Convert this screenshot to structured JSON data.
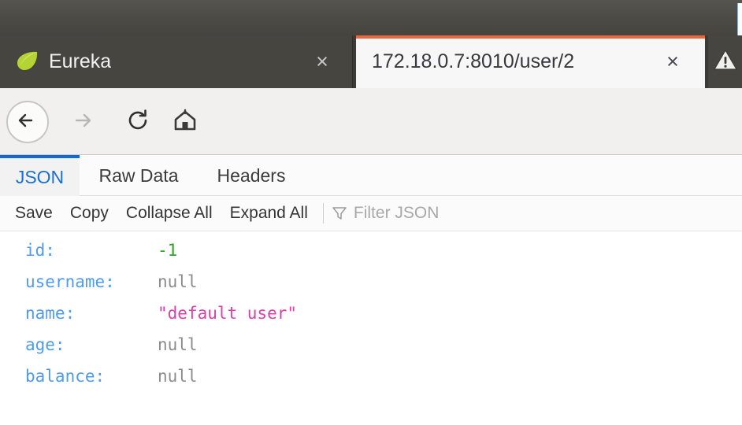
{
  "window": {
    "titlebar_color": "#4b4a45"
  },
  "tabs": {
    "accent_color": "#e8673d",
    "items": [
      {
        "title": "Eureka",
        "icon": "leaf-icon",
        "close_label": "×",
        "active": false
      },
      {
        "title": "172.18.0.7:8010/user/2",
        "icon": "none",
        "close_label": "×",
        "active": true
      },
      {
        "title": "",
        "icon": "warning-triangle-icon",
        "close_label": "",
        "active": false
      }
    ]
  },
  "navbar": {
    "back_label": "←",
    "forward_label": "→",
    "reload_label": "↻",
    "home_label": "⌂",
    "security_icon": "broken-lock-icon",
    "url_host": "172.18.0.7",
    "url_rest": ":8010/user/2",
    "url_full": "172.18.0.7:8010/user/2"
  },
  "viewer": {
    "tabs": [
      {
        "label": "JSON",
        "active": true
      },
      {
        "label": "Raw Data",
        "active": false
      },
      {
        "label": "Headers",
        "active": false
      }
    ],
    "active_tab_color": "#1a6fd4",
    "toolbar": {
      "save_label": "Save",
      "copy_label": "Copy",
      "collapse_all_label": "Collapse All",
      "expand_all_label": "Expand All",
      "filter_icon": "filter-funnel-icon",
      "filter_placeholder": "Filter JSON",
      "filter_value": ""
    },
    "rows": [
      {
        "key": "id:",
        "value": "-1",
        "type": "number"
      },
      {
        "key": "username:",
        "value": "null",
        "type": "null"
      },
      {
        "key": "name:",
        "value": "\"default user\"",
        "type": "string"
      },
      {
        "key": "age:",
        "value": "null",
        "type": "null"
      },
      {
        "key": "balance:",
        "value": "null",
        "type": "null"
      }
    ],
    "colors": {
      "key": "#4e9bf0",
      "number": "#28a428",
      "null": "#8c8c8c",
      "string": "#dd3fa8"
    }
  }
}
